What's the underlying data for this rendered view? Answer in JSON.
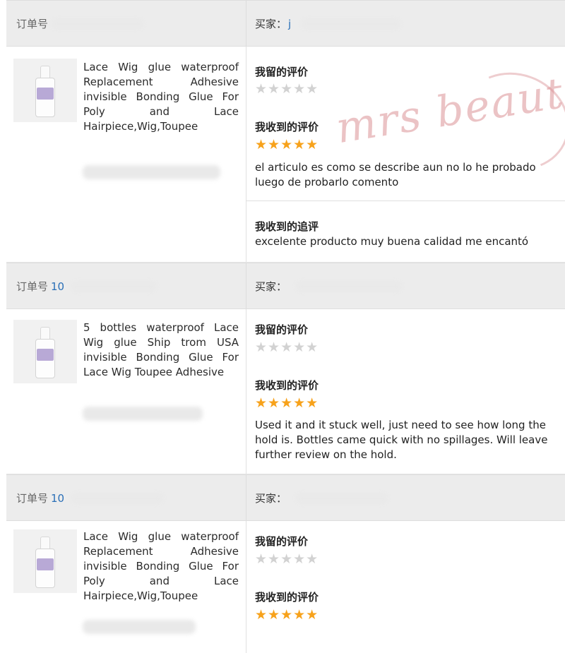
{
  "labels": {
    "order_no": "订单号",
    "buyer": "买家：",
    "my_rating": "我留的评价",
    "received_rating": "我收到的评价",
    "received_followup": "我收到的追评"
  },
  "orders": [
    {
      "order_no_visible": "",
      "buyer_visible": "j",
      "product_title": "Lace Wig glue waterproof Replacement Adhesive invisible Bonding Glue For Poly and Lace Hairpiece,Wig,Toupee",
      "my_rating_stars": 0,
      "received_rating_stars": 5,
      "review_text": "el articulo es como se describe aun no lo he probado luego de probarlo comento",
      "followup_text": "excelente producto muy buena calidad me encantó"
    },
    {
      "order_no_visible": "10",
      "buyer_visible": "",
      "product_title": "5 bottles waterproof Lace Wig glue Ship trom USA invisible Bonding Glue For Lace Wig Toupee Adhesive",
      "my_rating_stars": 0,
      "received_rating_stars": 5,
      "review_text": "Used it and it stuck well, just need to see how long the hold is. Bottles came quick with no spillages. Will leave further review on the hold.",
      "followup_text": ""
    },
    {
      "order_no_visible": "10",
      "buyer_visible": "",
      "product_title": "Lace Wig glue waterproof Replacement Adhesive invisible Bonding Glue For Poly and Lace Hairpiece,Wig,Toupee",
      "my_rating_stars": 0,
      "received_rating_stars": 5,
      "review_text": "",
      "followup_text": ""
    }
  ],
  "stars": {
    "full": "★★★★★",
    "empty": "★★★★★",
    "full_color": "#f7a21b",
    "empty_color": "#d2d2d2"
  },
  "watermark": "mrs beauty"
}
